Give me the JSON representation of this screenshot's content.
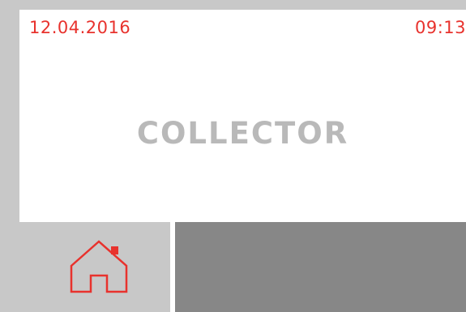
{
  "status": {
    "date": "12.04.2016",
    "time": "09:13"
  },
  "main": {
    "title": "COLLECTOR"
  },
  "footer": {
    "home_icon": "home-icon"
  },
  "colors": {
    "accent": "#e8322d",
    "title": "#b9b9b9",
    "frame": "#c8c8c8",
    "panel": "#878787",
    "screen": "#ffffff"
  }
}
